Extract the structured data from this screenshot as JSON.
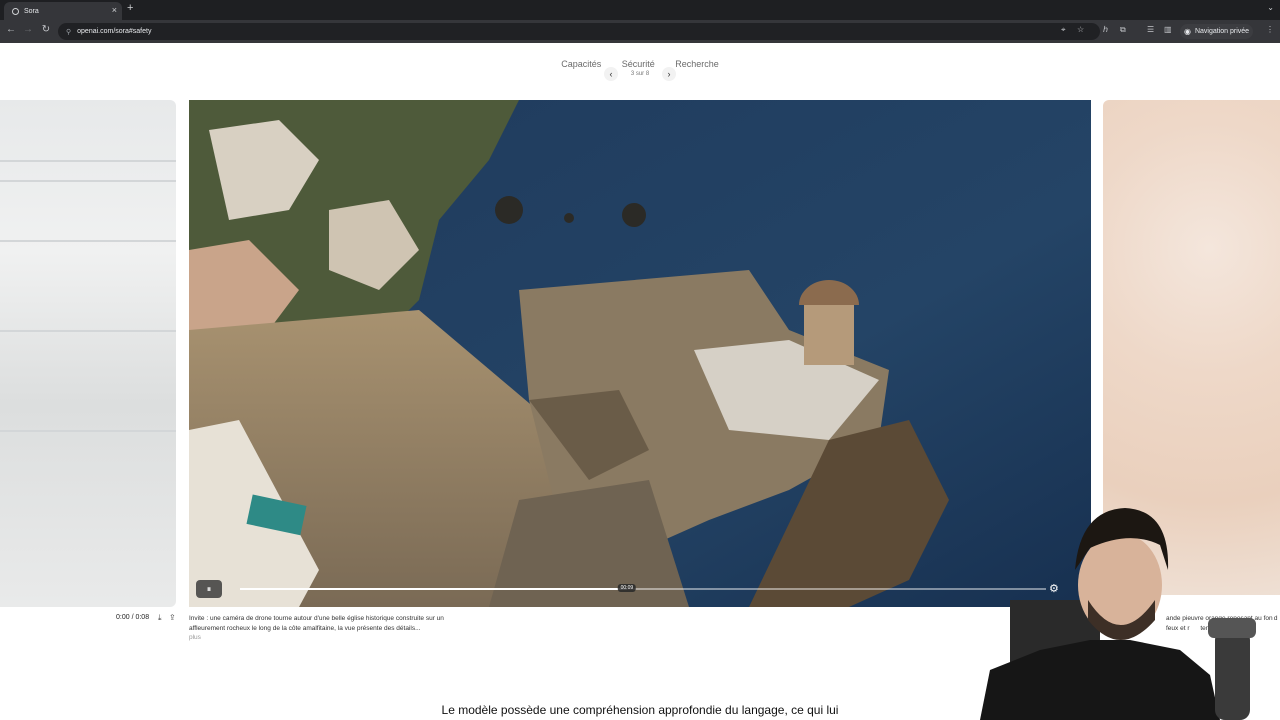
{
  "browser": {
    "tab_title": "Sora",
    "tab_close": "×",
    "new_tab": "+",
    "tab_menu": "⌄",
    "url": "openai.com/sora#safety",
    "private_label": "Navigation privée"
  },
  "page_nav": {
    "links": [
      "Capacités",
      "Sécurité",
      "Recherche"
    ],
    "pager_count": "3 sur 8"
  },
  "player": {
    "timecode": "0:00 / 0:08",
    "hover_time": "00:09",
    "progress": 0.48
  },
  "captions": {
    "main": "Invite : une caméra de drone tourne autour d'une belle église historique construite sur un affleurement rocheux le long de la côte amalfitaine, la vue présente des détails...",
    "more": "plus",
    "right": "ande pieuvre orange reposant au fon d\nfeux et r      tentacules son"
  },
  "subtitle": "Le modèle possède une compréhension approfondie du langage, ce qui lui",
  "icons": {
    "back": "←",
    "forward": "→",
    "reload": "↻",
    "pause": "⏸",
    "settings": "⚙",
    "download": "⤓",
    "share": "⇪"
  }
}
